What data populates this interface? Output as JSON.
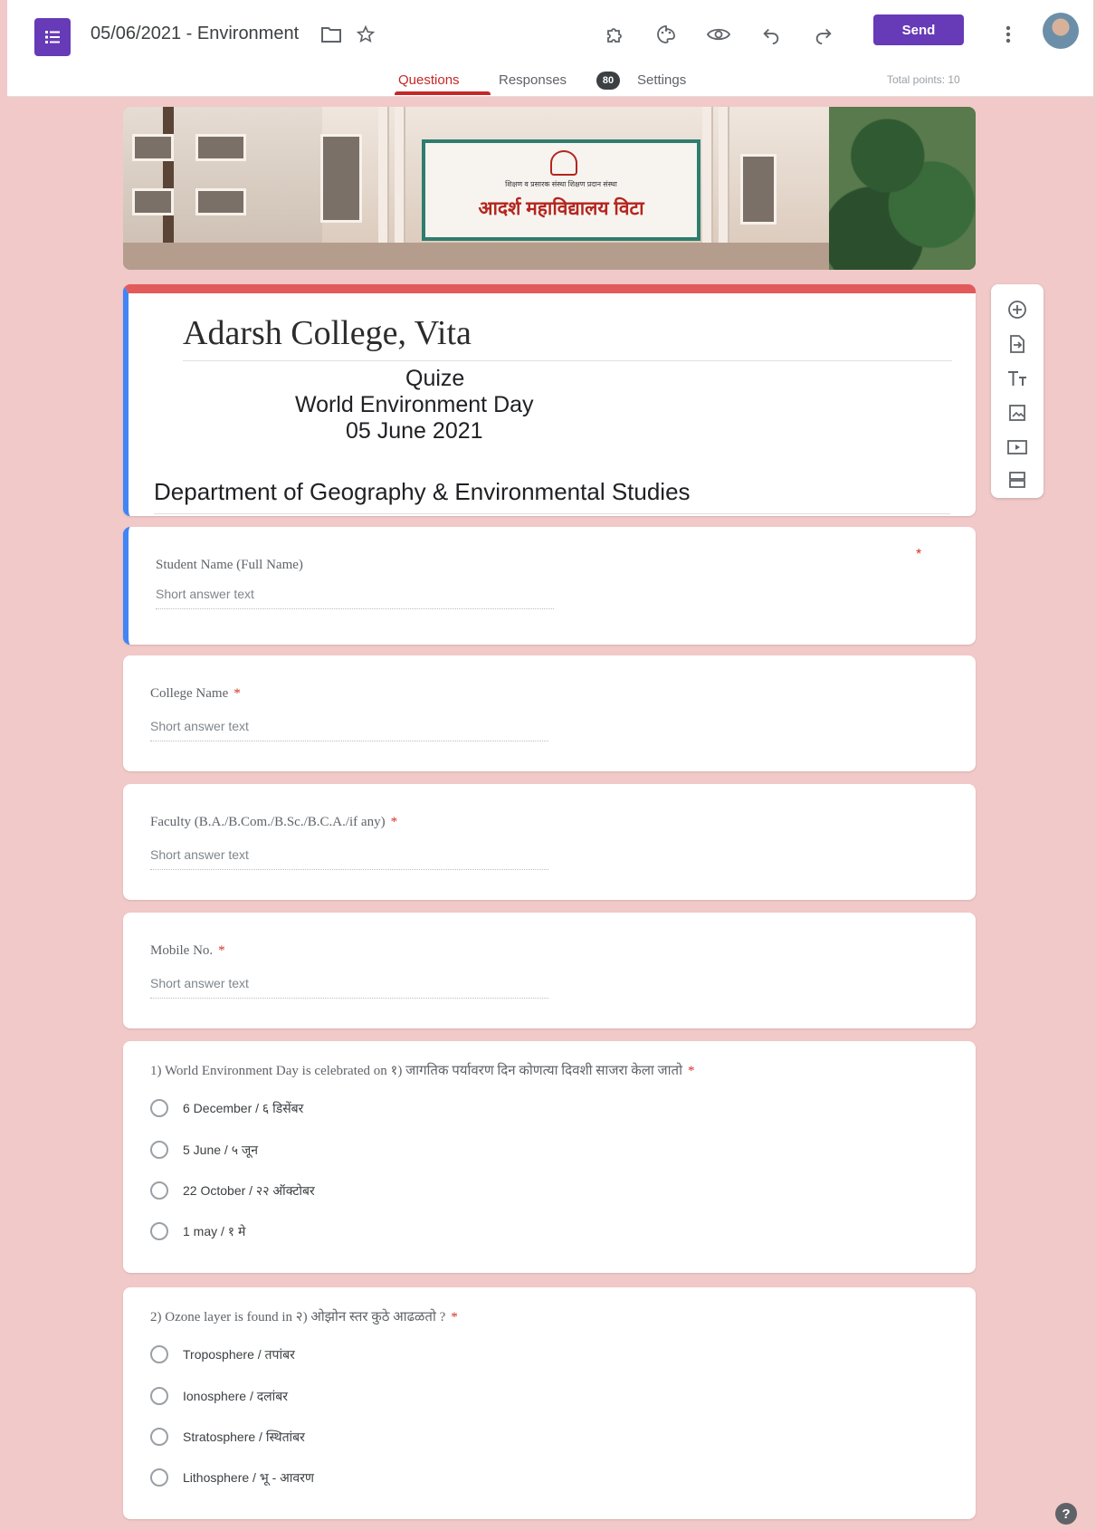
{
  "app": {
    "doc_title": "05/06/2021 - Environment",
    "send_label": "Send",
    "tabs": [
      {
        "label": "Questions"
      },
      {
        "label": "Responses",
        "badge": "80"
      },
      {
        "label": "Settings"
      }
    ],
    "total_points": "Total points: 10",
    "toolbar_icons": [
      "addon-icon",
      "palette-icon",
      "preview-eye-icon",
      "undo-icon",
      "redo-icon",
      "more-vert-icon"
    ],
    "accent_color": "#673ab7"
  },
  "banner": {
    "sign_subtext": "शिक्षण व प्रसारक संस्था शिक्षण प्रदान संस्था",
    "sign_text": "आदर्श महाविद्यालय विटा"
  },
  "header": {
    "title": "Adarsh College, Vita",
    "description": [
      "Quize",
      "World Environment Day",
      "05 June 2021"
    ],
    "department": "Department of Geography & Environmental Studies",
    "theme_color": "#e35a5a"
  },
  "questions": [
    {
      "title": "Student Name (Full Name)",
      "required": "*",
      "placeholder": "Short answer text"
    },
    {
      "title": "College Name",
      "required": "*",
      "placeholder": "Short answer text"
    },
    {
      "title": "Faculty (B.A./B.Com./B.Sc./B.C.A./if any)",
      "required": "*",
      "placeholder": "Short answer text"
    },
    {
      "title": "Mobile No.",
      "required": "*",
      "placeholder": "Short answer text"
    },
    {
      "title": "1) World Environment Day is celebrated on १) जागतिक पर्यावरण दिन कोणत्या दिवशी साजरा केला जातो",
      "required": "*",
      "options": [
        "6 December / ६ डिसेंबर",
        "5 June / ५ जून",
        "22 October / २२ ऑक्टोबर",
        "1 may / १ मे"
      ]
    },
    {
      "title": "2) Ozone layer is found in २) ओझोन स्तर कुठे आढळतो ?",
      "required": "*",
      "options": [
        "Troposphere / तपांबर",
        "Ionosphere / दलांबर",
        "Stratosphere / स्थितांबर",
        "Lithosphere  / भू - आवरण"
      ]
    }
  ],
  "side_toolbar": [
    "add-question-icon",
    "import-questions-icon",
    "add-title-icon",
    "add-image-icon",
    "add-video-icon",
    "add-section-icon"
  ],
  "help": "?"
}
